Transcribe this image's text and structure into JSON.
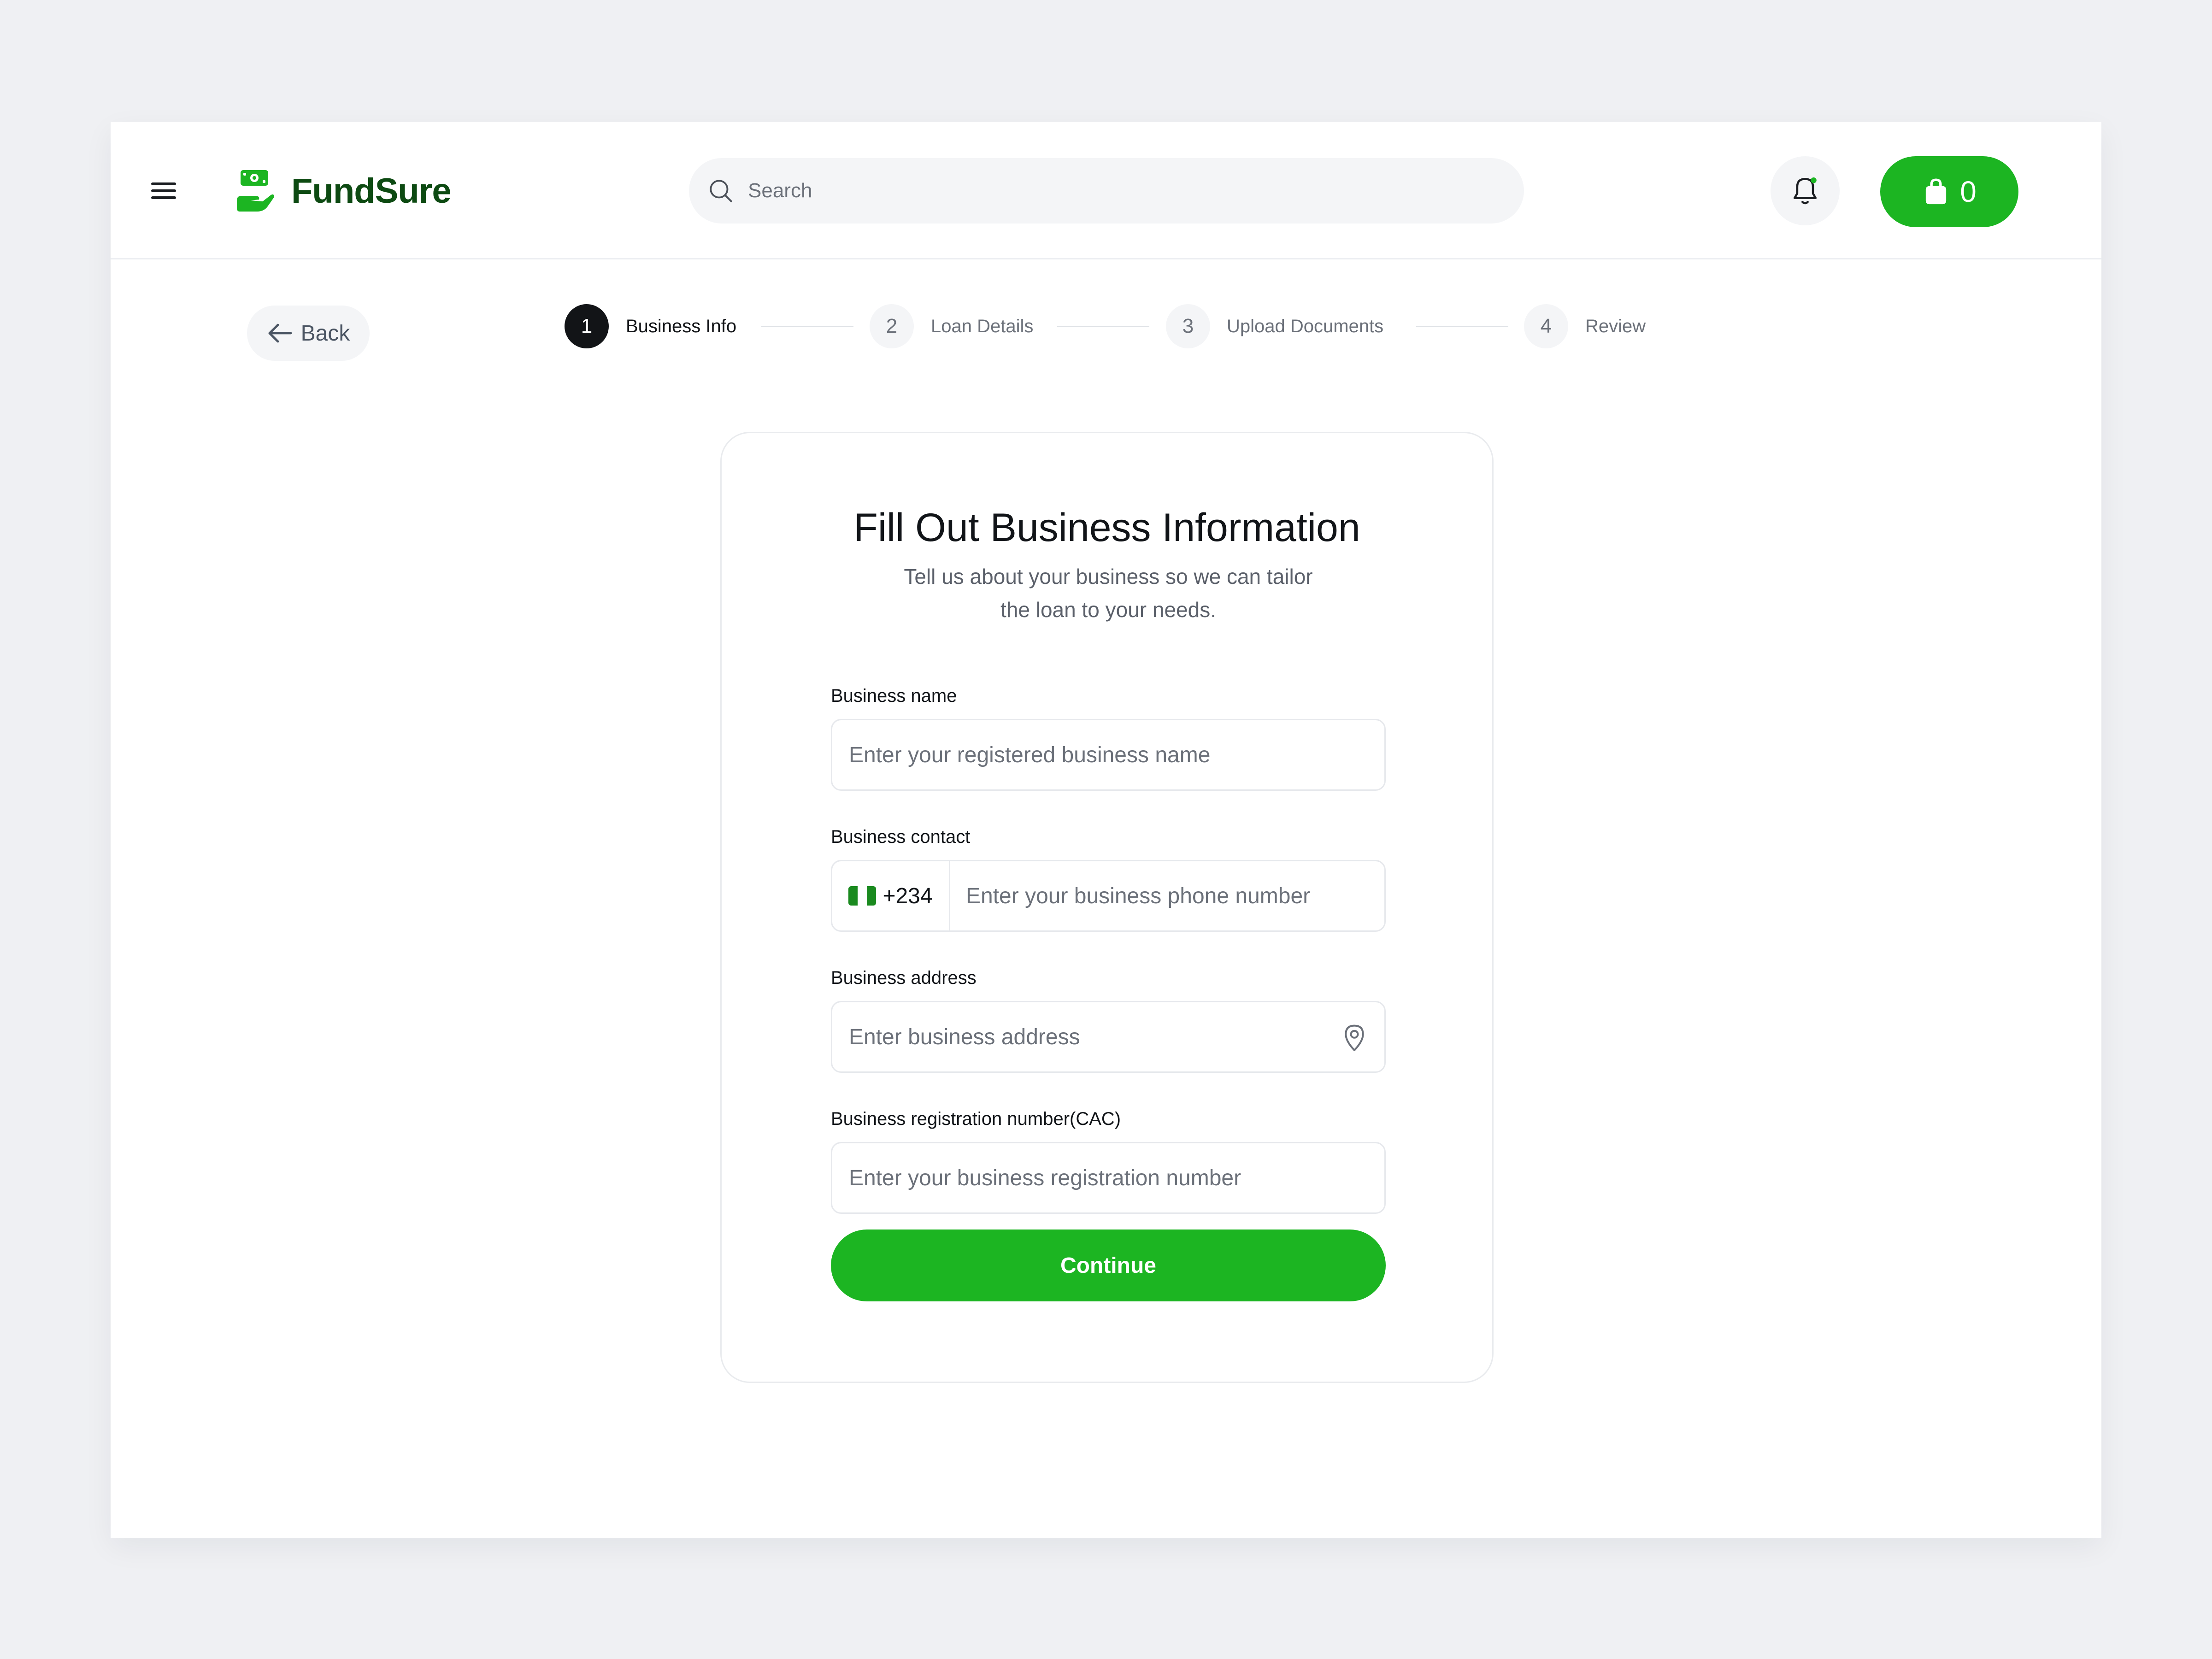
{
  "header": {
    "brand_name": "FundSure",
    "search_placeholder": "Search",
    "cart_count": "0"
  },
  "nav": {
    "back_label": "Back"
  },
  "stepper": {
    "steps": [
      {
        "number": "1",
        "label": "Business Info",
        "state": "active"
      },
      {
        "number": "2",
        "label": "Loan Details",
        "state": "upcoming"
      },
      {
        "number": "3",
        "label": "Upload Documents",
        "state": "upcoming"
      },
      {
        "number": "4",
        "label": "Review",
        "state": "upcoming"
      }
    ]
  },
  "form": {
    "title": "Fill Out Business Information",
    "subtitle_line1": "Tell us about your business so we can tailor",
    "subtitle_line2": "the loan to your needs.",
    "business_name": {
      "label": "Business name",
      "placeholder": "Enter your registered business name",
      "value": ""
    },
    "business_contact": {
      "label": "Business contact",
      "country_code": "+234",
      "placeholder": "Enter your business phone number",
      "value": ""
    },
    "business_address": {
      "label": "Business address",
      "placeholder": "Enter business address",
      "value": ""
    },
    "registration_number": {
      "label": "Business registration number(CAC)",
      "placeholder": "Enter your business registration number",
      "value": ""
    },
    "continue_label": "Continue"
  },
  "icons": {
    "menu": "menu-icon",
    "logo": "hand-money-logo-icon",
    "search": "search-icon",
    "bell": "bell-icon",
    "cart": "shopping-bag-icon",
    "back": "arrow-left-icon",
    "flag": "nigeria-flag-icon",
    "pin": "map-pin-icon"
  },
  "colors": {
    "accent_green": "#1cb522",
    "brand_dark_green": "#0d4a12",
    "active_step": "#121417",
    "page_bg": "#eff0f3"
  }
}
